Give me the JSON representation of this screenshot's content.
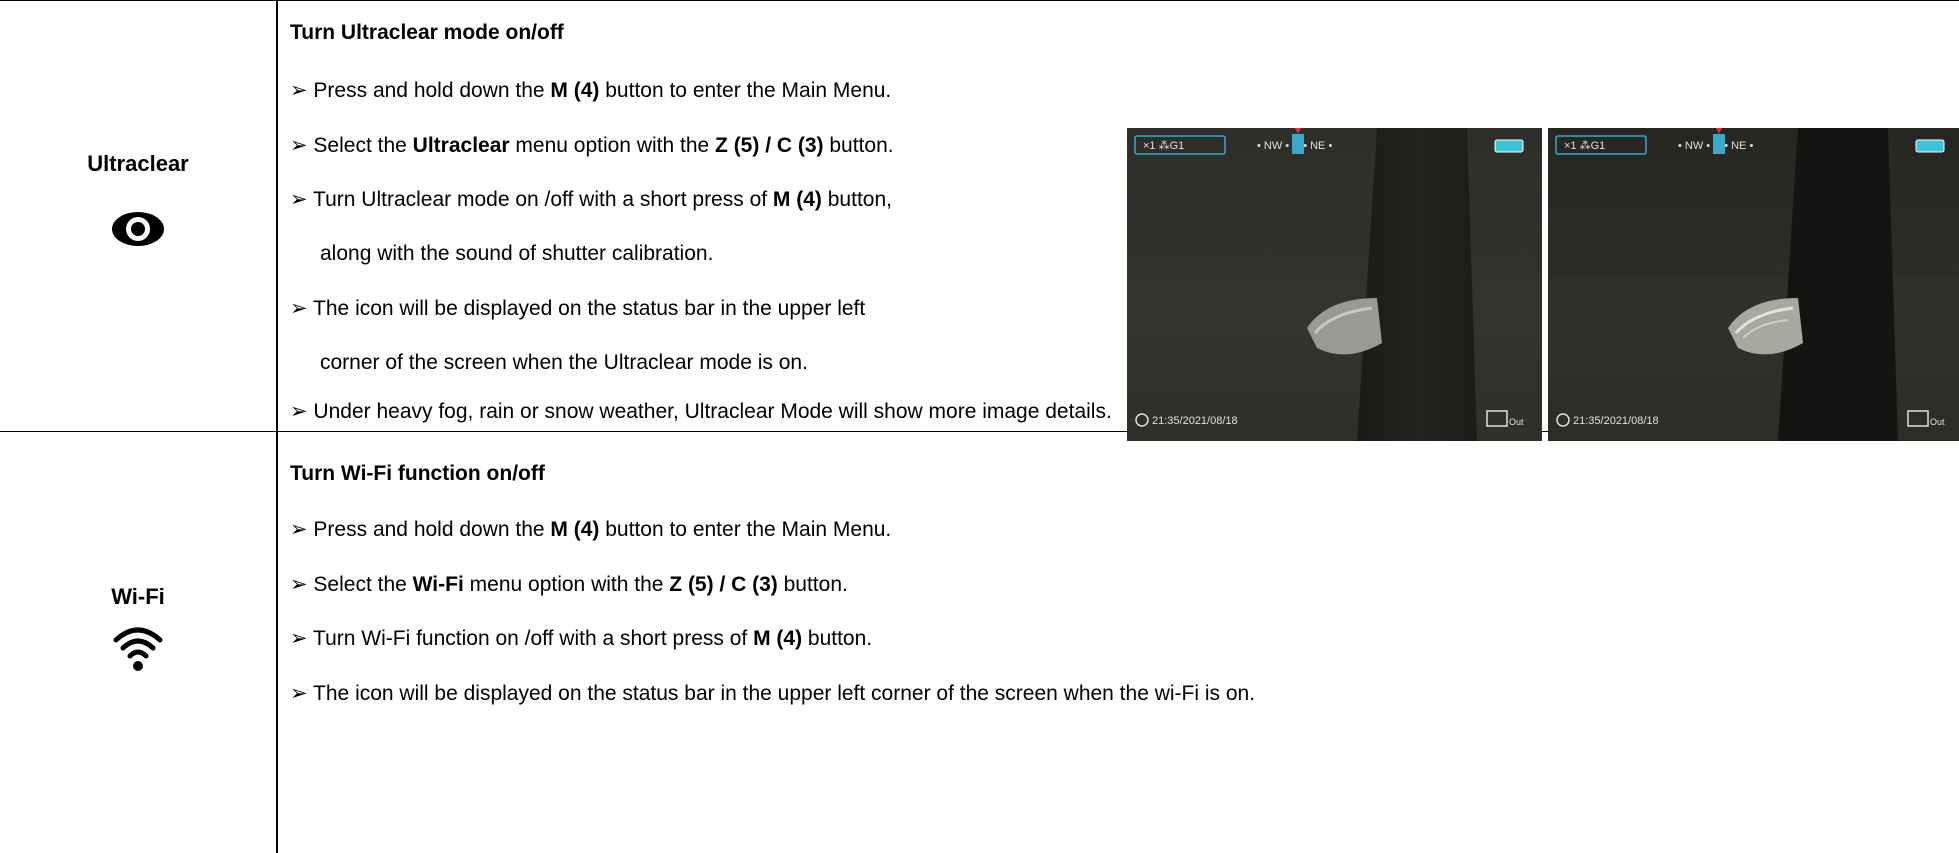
{
  "ultraclear": {
    "label": "Ultraclear",
    "icon": "eye-icon",
    "title": "Turn Ultraclear mode on/off",
    "step1": {
      "prefix": "➢ Press and hold down the ",
      "bold": "M (4)",
      "suffix": " button to enter the Main Menu."
    },
    "step2": {
      "prefix": "➢ Select the ",
      "bold1": "Ultraclear",
      "mid": " menu option with the ",
      "bold2": "Z (5) / C (3)",
      "suffix": " button."
    },
    "step3a": {
      "prefix": "➢ Turn Ultraclear mode on /off with a short press of ",
      "bold": "M (4)",
      "suffix": " button,"
    },
    "step3b": "along with the sound of shutter calibration.",
    "step4a": "➢ The icon will be displayed on the status bar in the upper left",
    "step4b": "corner of the screen when the Ultraclear mode is on.",
    "step5": "➢ Under heavy fog, rain or snow weather, Ultraclear Mode will show more image details.",
    "screens": [
      {
        "status": "×1 ⁂G1",
        "compass": "• NW •  N  • NE •",
        "timestamp": "21:35/2021/08/18",
        "out": "Out"
      },
      {
        "status": "×1 ⁂G1",
        "compass": "• NW •  N  • NE •",
        "timestamp": "21:35/2021/08/18",
        "out": "Out"
      }
    ]
  },
  "wifi": {
    "label": "Wi-Fi",
    "icon": "wifi-icon",
    "title": "Turn Wi-Fi function on/off",
    "step1": {
      "prefix": "➢ Press and hold down the ",
      "bold": "M (4)",
      "suffix": " button to enter the Main Menu."
    },
    "step2": {
      "prefix": "➢ Select the ",
      "bold1": "Wi-Fi",
      "mid": " menu option with the ",
      "bold2": "Z (5) / C (3)",
      "suffix": " button."
    },
    "step3": {
      "prefix": "➢ Turn Wi-Fi function on /off with a short press of ",
      "bold": "M (4)",
      "suffix": " button."
    },
    "step4": "➢ The icon will be displayed on the status bar in the upper left corner of the screen when the wi-Fi is on."
  },
  "colors": {
    "border": "#000000",
    "screen_bg": "#2a2a25",
    "battery": "#3cc4d6",
    "status_box": "#3aa9c9",
    "compass_marker": "#e0343a"
  }
}
